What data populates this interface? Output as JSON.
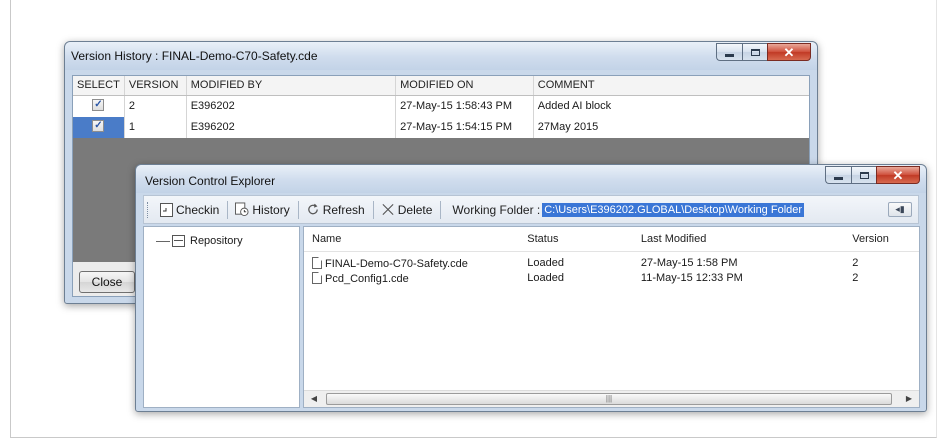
{
  "version_history": {
    "title": "Version History : FINAL-Demo-C70-Safety.cde",
    "columns": [
      "SELECT",
      "VERSION",
      "MODIFIED BY",
      "MODIFIED ON",
      "COMMENT"
    ],
    "rows": [
      {
        "checked": "✓",
        "version": "2",
        "modified_by": "E396202",
        "modified_on": "27-May-15 1:58:43 PM",
        "comment": "Added AI block"
      },
      {
        "checked": "✓",
        "version": "1",
        "modified_by": "E396202",
        "modified_on": "27-May-15 1:54:15 PM",
        "comment": "27May 2015"
      }
    ],
    "close_label": "Close"
  },
  "vce": {
    "title": "Version Control Explorer",
    "toolbar": {
      "checkin": "Checkin",
      "history": "History",
      "refresh": "Refresh",
      "delete": "Delete",
      "working_folder_label": "Working Folder :",
      "working_folder_value": "C:\\Users\\E396202.GLOBAL\\Desktop\\Working Folder"
    },
    "tree": {
      "root": "Repository"
    },
    "columns": [
      "Name",
      "Status",
      "Last Modified",
      "Version"
    ],
    "files": [
      {
        "name": "FINAL-Demo-C70-Safety.cde",
        "status": "Loaded",
        "modified": "27-May-15 1:58 PM",
        "version": "2"
      },
      {
        "name": "Pcd_Config1.cde",
        "status": "Loaded",
        "modified": "11-May-15 12:33 PM",
        "version": "2"
      }
    ]
  }
}
